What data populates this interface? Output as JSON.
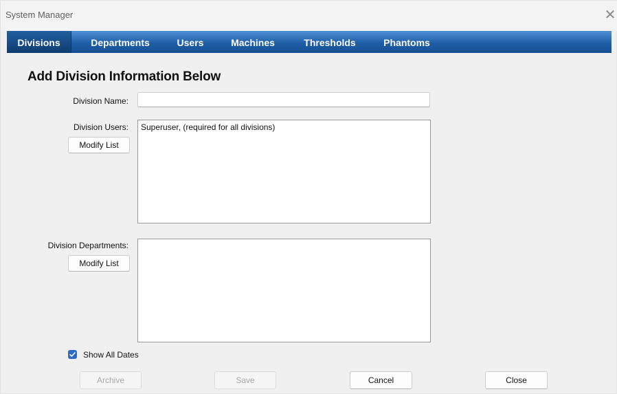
{
  "window": {
    "title": "System Manager"
  },
  "tabs": [
    {
      "label": "Divisions",
      "active": true
    },
    {
      "label": "Departments",
      "active": false
    },
    {
      "label": "Users",
      "active": false
    },
    {
      "label": "Machines",
      "active": false
    },
    {
      "label": "Thresholds",
      "active": false
    },
    {
      "label": "Phantoms",
      "active": false
    }
  ],
  "form": {
    "heading": "Add Division Information Below",
    "division_name_label": "Division Name:",
    "division_name_value": "",
    "division_users_label": "Division Users:",
    "division_users_items": [
      "Superuser, (required for all divisions)"
    ],
    "division_departments_label": "Division Departments:",
    "modify_list_label": "Modify List",
    "show_all_dates_label": "Show All Dates",
    "show_all_dates_checked": true
  },
  "actions": {
    "archive": "Archive",
    "save": "Save",
    "cancel": "Cancel",
    "close": "Close"
  },
  "colors": {
    "tab_bar": "#1f5fa6",
    "active_tab": "#0e3d72",
    "checkbox": "#2b6cc4"
  },
  "icons": {
    "close": "close-icon",
    "checkbox": "checkmark-icon"
  }
}
